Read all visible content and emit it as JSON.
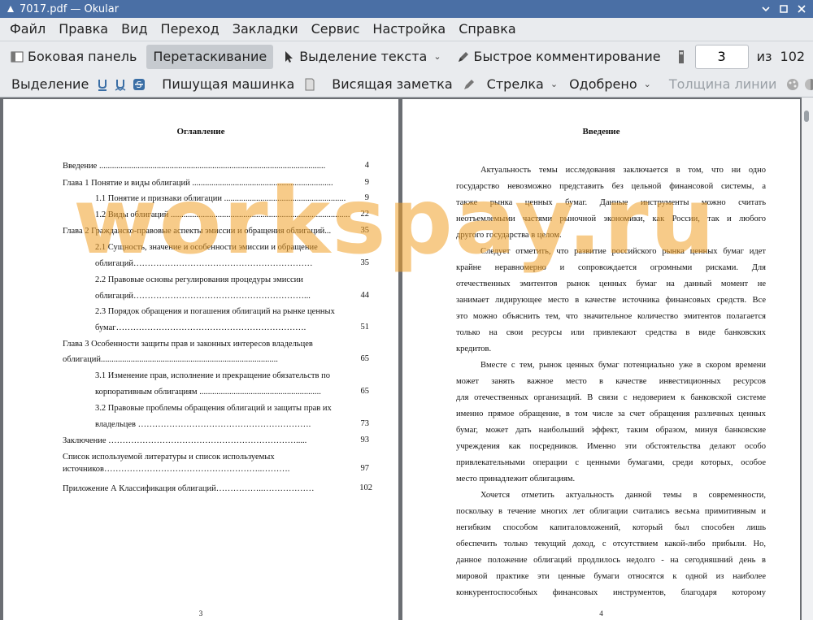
{
  "window": {
    "title": "7017.pdf  — Okular"
  },
  "menu": [
    "Файл",
    "Правка",
    "Вид",
    "Переход",
    "Закладки",
    "Сервис",
    "Настройка",
    "Справка"
  ],
  "toolbar1": {
    "sidebar": "Боковая панель",
    "drag": "Перетаскивание",
    "text_select": "Выделение текста",
    "quick_comment": "Быстрое комментирование",
    "page_current": "3",
    "page_of": "из",
    "page_total": "102"
  },
  "toolbar2": {
    "selection": "Выделение",
    "typewriter": "Пишущая машинка",
    "note": "Висящая заметка",
    "arrow": "Стрелка",
    "stamp": "Одобрено",
    "line_width": "Толщина линии"
  },
  "left_page": {
    "heading": "Оглавление",
    "toc": [
      {
        "text": "Введение",
        "page": "4"
      },
      {
        "text": "Глава 1 Понятие и виды облигаций",
        "page": "9"
      },
      {
        "text": "1.1 Понятие и признаки облигации",
        "page": "9"
      },
      {
        "text": "1.2 Виды облигаций",
        "page": "22"
      },
      {
        "text": "Глава 2 Гражданско-правовые аспекты эмиссии и обращения облигаций...",
        "page": "35"
      },
      {
        "text": "2.1  Сущность,  значение  и  особенности  эмиссии  и  обращение",
        "page": ""
      },
      {
        "text": "облигаций",
        "page": "35"
      },
      {
        "text": "2.2   Правовые   основы   регулирования   процедуры   эмиссии",
        "page": ""
      },
      {
        "text": "облигаций",
        "page": "44"
      },
      {
        "text": "2.3  Порядок  обращения  и  погашения  облигаций  на  рынке  ценных",
        "page": ""
      },
      {
        "text": "бумаг",
        "page": "51"
      },
      {
        "text": "Глава  3  Особенности  защиты  прав  и  законных  интересов  владельцев",
        "page": ""
      },
      {
        "text": "облигаций",
        "page": "65"
      },
      {
        "text": "3.1  Изменение  прав,  исполнение  и  прекращение  обязательств  по",
        "page": ""
      },
      {
        "text": "корпоративным облигациям",
        "page": "65"
      },
      {
        "text": "3.2  Правовые  проблемы  обращения  облигаций  и  защиты  прав  их",
        "page": ""
      },
      {
        "text": "владельцев",
        "page": "73"
      },
      {
        "text": "Заключение",
        "page": "93"
      },
      {
        "text": "Список используемой литературы и список используемых",
        "page": ""
      },
      {
        "text": "источников",
        "page": "97"
      },
      {
        "text": "Приложение А Классификация облигаций",
        "page": "102"
      }
    ],
    "page_number": "3"
  },
  "right_page": {
    "heading": "Введение",
    "lines": [
      "Актуальность темы исследования заключается в том, что ни одно",
      "государство невозможно представить без цельной финансовой системы, а",
      "также рынка ценных бумаг. Данные инструменты можно считать",
      "неотъемлемыми частями рыночной экономики, как России, так и любого",
      "другого государства в целом.",
      "Следует отметить, что развитие российского рынка ценных бумаг идет",
      "крайне неравномерно и сопровождается огромными рисками. Для",
      "отечественных эмитентов рынок ценных бумаг на данный момент не",
      "занимает лидирующее место в качестве источника финансовых средств. Все",
      "это можно объяснить тем, что значительное количество эмитентов полагается",
      "только на свои ресурсы или привлекают средства в виде банковских",
      "кредитов.",
      "Вместе с тем, рынок ценных бумаг потенциально уже в скором времени",
      "может занять важное место в качестве инвестиционных ресурсов",
      "для отечественных организаций. В связи с недоверием к банковской системе",
      "именно прямое обращение, в том числе за счет обращения различных ценных",
      "бумаг, может дать наибольший эффект, таким образом, минуя банковские",
      "учреждения как посредников. Именно эти обстоятельства делают особо",
      "привлекательными операции с ценными бумагами, среди которых, особое",
      "место принадлежит облигациям.",
      "Хочется отметить актуальность данной темы в современности,",
      "поскольку в течение многих лет облигации считались весьма примитивным и",
      "негибким способом капиталовложений, который был способен лишь",
      "обеспечить только текущий доход, с отсутствием какой-либо прибыли. Но,",
      "данное положение облигаций продлилось недолго - на сегодняшний день в",
      "мировой практике эти ценные бумаги относятся к одной из наиболее",
      "конкурентоспособных финансовых инструментов, благодаря которому"
    ],
    "page_number": "4"
  },
  "watermark": "workspay.ru"
}
